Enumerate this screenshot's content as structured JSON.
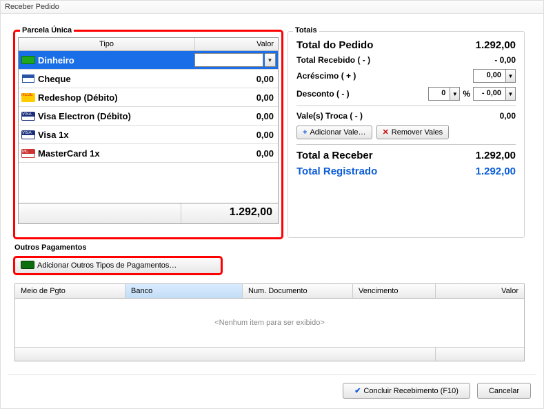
{
  "window": {
    "title": "Receber Pedido"
  },
  "parcela": {
    "legend": "Parcela Única",
    "col_tipo": "Tipo",
    "col_valor": "Valor",
    "rows": [
      {
        "name": "Dinheiro",
        "value": "",
        "selected": true
      },
      {
        "name": "Cheque",
        "value": "0,00"
      },
      {
        "name": "Redeshop (Débito)",
        "value": "0,00"
      },
      {
        "name": "Visa Electron (Débito)",
        "value": "0,00"
      },
      {
        "name": "Visa 1x",
        "value": "0,00"
      },
      {
        "name": "MasterCard 1x",
        "value": "0,00"
      }
    ],
    "total": "1.292,00"
  },
  "totais": {
    "legend": "Totais",
    "total_pedido_label": "Total do Pedido",
    "total_pedido_value": "1.292,00",
    "total_recebido_label": "Total Recebido ( - )",
    "total_recebido_value": "- 0,00",
    "acrescimo_label": "Acréscimo ( + )",
    "acrescimo_value": "0,00",
    "desconto_label": "Desconto ( - )",
    "desconto_pct": "0",
    "desconto_pct_unit": "%",
    "desconto_value": "- 0,00",
    "vales_label": "Vale(s) Troca ( - )",
    "vales_value": "0,00",
    "btn_add_vale": "Adicionar Vale…",
    "btn_rem_vale": "Remover Vales",
    "total_receber_label": "Total a Receber",
    "total_receber_value": "1.292,00",
    "total_registrado_label": "Total Registrado",
    "total_registrado_value": "1.292,00"
  },
  "outros": {
    "legend": "Outros Pagamentos",
    "btn_add": "Adicionar Outros Tipos de Pagamentos…"
  },
  "grid": {
    "cols": {
      "c1": "Meio de Pgto",
      "c2": "Banco",
      "c3": "Num. Documento",
      "c4": "Vencimento",
      "c5": "Valor"
    },
    "empty": "<Nenhum item para ser exibido>"
  },
  "buttons": {
    "concluir": "Concluir Recebimento (F10)",
    "cancelar": "Cancelar"
  }
}
